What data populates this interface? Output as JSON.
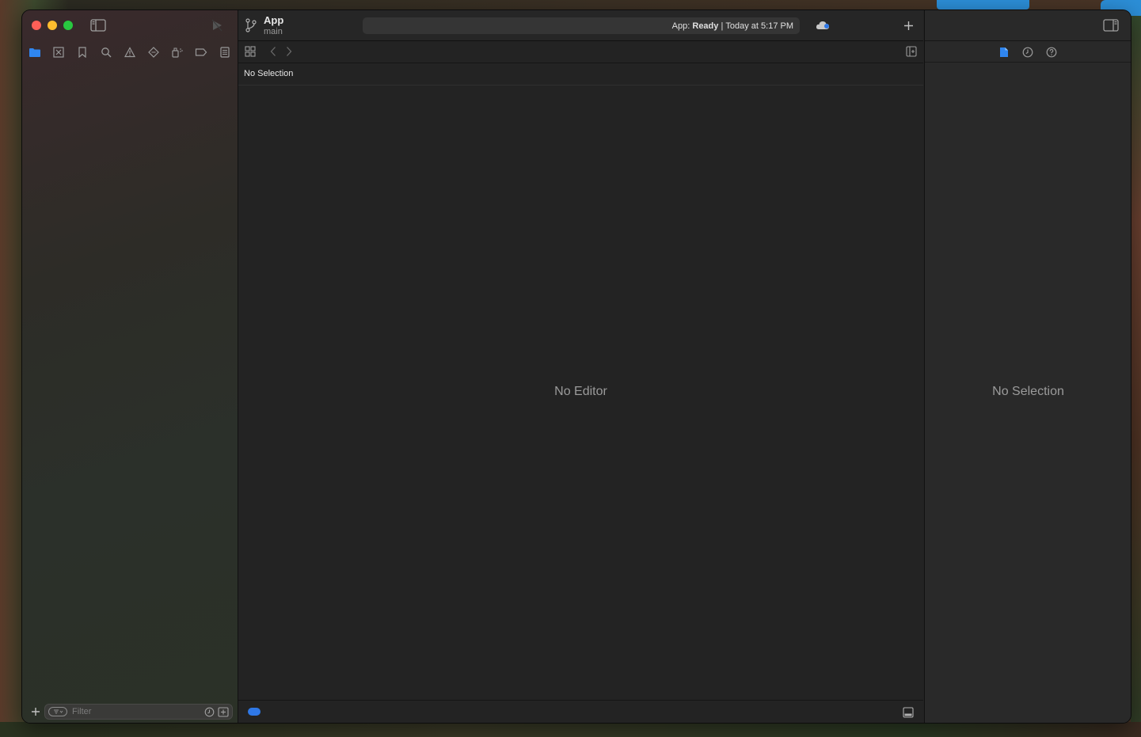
{
  "window": {
    "traffic_lights": [
      "close",
      "minimize",
      "zoom"
    ],
    "accent_color": "#2f78e6"
  },
  "toolbar": {
    "scheme_name": "App",
    "branch_name": "main",
    "activity_project": "App:",
    "activity_status": "Ready",
    "activity_separator": "|",
    "activity_time": "Today at 5:17 PM"
  },
  "navigator": {
    "tabs": [
      {
        "name": "project-navigator",
        "icon": "folder-icon",
        "active": true
      },
      {
        "name": "source-control-navigator",
        "icon": "source-control-icon"
      },
      {
        "name": "bookmark-navigator",
        "icon": "bookmark-icon"
      },
      {
        "name": "find-navigator",
        "icon": "search-icon"
      },
      {
        "name": "issue-navigator",
        "icon": "warning-icon"
      },
      {
        "name": "test-navigator",
        "icon": "test-diamond-icon"
      },
      {
        "name": "debug-navigator",
        "icon": "debug-spray-icon"
      },
      {
        "name": "breakpoint-navigator",
        "icon": "breakpoint-icon"
      },
      {
        "name": "report-navigator",
        "icon": "report-icon"
      }
    ],
    "filter_placeholder": "Filter"
  },
  "editor": {
    "breadcrumb": "No Selection",
    "empty_message": "No Editor"
  },
  "inspector": {
    "tabs": [
      "file-inspector",
      "history-inspector",
      "quick-help-inspector"
    ],
    "empty_message": "No Selection"
  }
}
